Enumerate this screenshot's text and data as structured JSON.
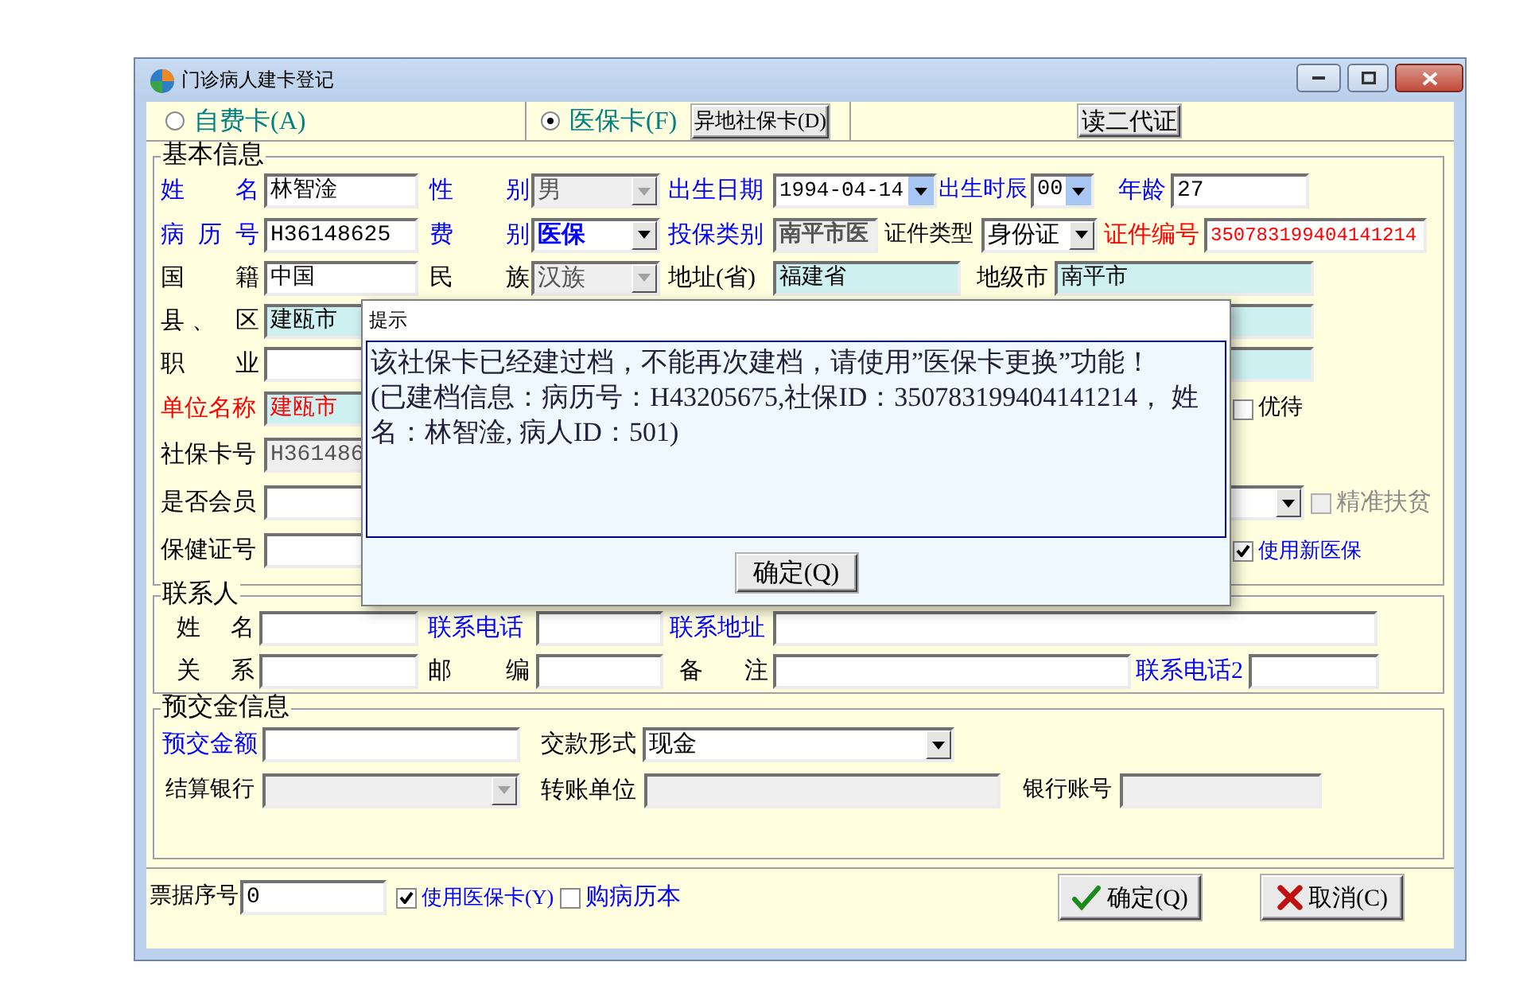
{
  "window": {
    "title": "门诊病人建卡登记"
  },
  "card_types": [
    {
      "label": "自费卡(A)",
      "selected": false
    },
    {
      "label": "医保卡(F)",
      "selected": true
    }
  ],
  "top_buttons": [
    "异地社保卡(D)",
    "读二代证"
  ],
  "basic_info": {
    "title": "基本信息",
    "rows": [
      {
        "items": [
          {
            "kind": "label",
            "text": "姓 名",
            "color": "#0000ff"
          },
          {
            "kind": "field",
            "value": "林智淦",
            "readonly": false,
            "disabled": false
          },
          {
            "kind": "label",
            "text": "性 别",
            "color": "#0000ff"
          },
          {
            "kind": "dropdown",
            "value": "男",
            "disabled": true
          },
          {
            "kind": "label",
            "text": "出生日期",
            "color": "#0000ff"
          },
          {
            "kind": "picker",
            "value": "1994-04-14",
            "disabled": false
          },
          {
            "kind": "label",
            "text": "出生时辰",
            "color": "#0000ff"
          },
          {
            "kind": "picker",
            "value": "00",
            "disabled": false
          },
          {
            "kind": "label",
            "text": "年龄",
            "color": "#0000ff"
          },
          {
            "kind": "field",
            "value": "27",
            "readonly": false,
            "disabled": false
          }
        ]
      },
      {
        "items": [
          {
            "kind": "label",
            "text": "病 历 号",
            "color": "#0000ff"
          },
          {
            "kind": "field",
            "value": "H36148625",
            "readonly": false,
            "disabled": false
          },
          {
            "kind": "label",
            "text": "费 别",
            "color": "#0000ff"
          },
          {
            "kind": "dropdown",
            "value": "医保",
            "disabled": false,
            "bold": true,
            "color": "#0000ff"
          },
          {
            "kind": "label",
            "text": "投保类别",
            "color": "#0000ff"
          },
          {
            "kind": "field",
            "value": "南平市医",
            "disabled": true,
            "bold": true
          },
          {
            "kind": "label",
            "text": "证件类型",
            "color": "#000000"
          },
          {
            "kind": "dropdown",
            "value": "身份证",
            "disabled": false
          },
          {
            "kind": "label",
            "text": "证件编号",
            "color": "#ff0000"
          },
          {
            "kind": "field",
            "value": "350783199404141214",
            "readonly": false,
            "disabled": false,
            "color": "#ff0000"
          }
        ]
      },
      {
        "items": [
          {
            "kind": "label",
            "text": "国 籍",
            "color": "#000000"
          },
          {
            "kind": "field",
            "value": "中国",
            "readonly": false,
            "disabled": false
          },
          {
            "kind": "label",
            "text": "民 族",
            "color": "#000000"
          },
          {
            "kind": "dropdown",
            "value": "汉族",
            "disabled": true
          },
          {
            "kind": "label",
            "text": "地址(省)",
            "color": "#000000"
          },
          {
            "kind": "field",
            "value": "福建省",
            "readonly": true,
            "disabled": false
          },
          {
            "kind": "label",
            "text": "地级市",
            "color": "#000000"
          },
          {
            "kind": "field",
            "value": "南平市",
            "readonly": true,
            "disabled": false
          }
        ]
      },
      {
        "items": [
          {
            "kind": "label",
            "text": "县、 区",
            "color": "#000000"
          },
          {
            "kind": "field",
            "value": "建瓯市",
            "readonly": true,
            "disabled": false
          },
          {
            "kind": "field",
            "readonly": true,
            "disabled": false
          }
        ]
      },
      {
        "items": [
          {
            "kind": "label",
            "text": "职 业",
            "color": "#000000"
          },
          {
            "kind": "field",
            "readonly": false,
            "disabled": false
          },
          {
            "kind": "field",
            "readonly": true,
            "disabled": false
          }
        ]
      },
      {
        "items": [
          {
            "kind": "label",
            "text": "单位名称",
            "color": "#ff0000"
          },
          {
            "kind": "field",
            "value": "建瓯市",
            "readonly": true,
            "disabled": false,
            "color": "#ff0000"
          },
          {
            "kind": "checkbox",
            "label": "优待",
            "checked": false,
            "disabled": false,
            "color": "#000000"
          }
        ]
      },
      {
        "items": [
          {
            "kind": "label",
            "text": "社保卡号",
            "color": "#000000"
          },
          {
            "kind": "field",
            "value": "H361486",
            "disabled": true
          }
        ]
      },
      {
        "items": [
          {
            "kind": "label",
            "text": "是否会员",
            "color": "#000000"
          },
          {
            "kind": "field",
            "readonly": false,
            "disabled": false
          },
          {
            "kind": "dropdown",
            "disabled": false
          },
          {
            "kind": "checkbox",
            "label": "精准扶贫",
            "checked": false,
            "disabled": true
          }
        ]
      },
      {
        "items": [
          {
            "kind": "label",
            "text": "保健证号",
            "color": "#000000"
          },
          {
            "kind": "field",
            "readonly": false,
            "disabled": false
          },
          {
            "kind": "checkbox",
            "label": "使用新医保",
            "checked": true,
            "disabled": false,
            "color": "#0000ff"
          }
        ]
      }
    ]
  },
  "contact": {
    "title": "联系人",
    "rows": [
      {
        "items": [
          {
            "kind": "label",
            "text": "姓 名",
            "color": "#000000"
          },
          {
            "kind": "field",
            "readonly": false,
            "disabled": false
          },
          {
            "kind": "label",
            "text": "联系电话",
            "color": "#0000ff"
          },
          {
            "kind": "field",
            "readonly": false,
            "disabled": false
          },
          {
            "kind": "label",
            "text": "联系地址",
            "color": "#0000ff"
          },
          {
            "kind": "field",
            "readonly": false,
            "disabled": false
          }
        ]
      },
      {
        "items": [
          {
            "kind": "label",
            "text": "关 系",
            "color": "#000000"
          },
          {
            "kind": "field",
            "readonly": false,
            "disabled": false
          },
          {
            "kind": "label",
            "text": "邮 编",
            "color": "#000000"
          },
          {
            "kind": "field",
            "readonly": false,
            "disabled": false
          },
          {
            "kind": "label",
            "text": "备 注",
            "color": "#000000"
          },
          {
            "kind": "field",
            "readonly": false,
            "disabled": false
          },
          {
            "kind": "label",
            "text": "联系电话2",
            "color": "#0000ff"
          },
          {
            "kind": "field",
            "readonly": false,
            "disabled": false
          }
        ]
      }
    ]
  },
  "prepayment": {
    "title": "预交金信息",
    "rows": [
      {
        "items": [
          {
            "kind": "label",
            "text": "预交金额",
            "color": "#0000ff"
          },
          {
            "kind": "field",
            "readonly": false,
            "disabled": false
          },
          {
            "kind": "label",
            "text": "交款形式",
            "color": "#000000"
          },
          {
            "kind": "dropdown",
            "value": "现金",
            "disabled": false
          }
        ]
      },
      {
        "items": [
          {
            "kind": "label",
            "text": "结算银行",
            "color": "#000000"
          },
          {
            "kind": "dropdown",
            "disabled": true
          },
          {
            "kind": "label",
            "text": "转账单位",
            "color": "#000000"
          },
          {
            "kind": "field",
            "disabled": true
          },
          {
            "kind": "label",
            "text": "银行账号",
            "color": "#000000"
          },
          {
            "kind": "field",
            "disabled": true
          }
        ]
      }
    ]
  },
  "footer": {
    "items": [
      {
        "kind": "label",
        "text": "票据序号",
        "color": "#000000"
      },
      {
        "kind": "field",
        "value": "0",
        "readonly": false,
        "disabled": false
      },
      {
        "kind": "checkbox",
        "label": "使用医保卡(Y)",
        "checked": true,
        "disabled": false,
        "color": "#0000ff"
      },
      {
        "kind": "checkbox",
        "label": "购病历本",
        "checked": false,
        "disabled": false,
        "color": "#0000ff"
      },
      {
        "kind": "button",
        "label": "确定(Q)"
      },
      {
        "kind": "button",
        "label": "取消(C)"
      }
    ]
  },
  "dialog": {
    "title": "提示",
    "message": [
      "该社保卡已经建过档，不能再次建档，请使用”医保卡更换”功能！",
      "(已建档信息：病历号：H43205675,社保ID：350783199404141214， 姓名：林智淦, 病人ID：501)"
    ],
    "button": "确定(Q)"
  }
}
